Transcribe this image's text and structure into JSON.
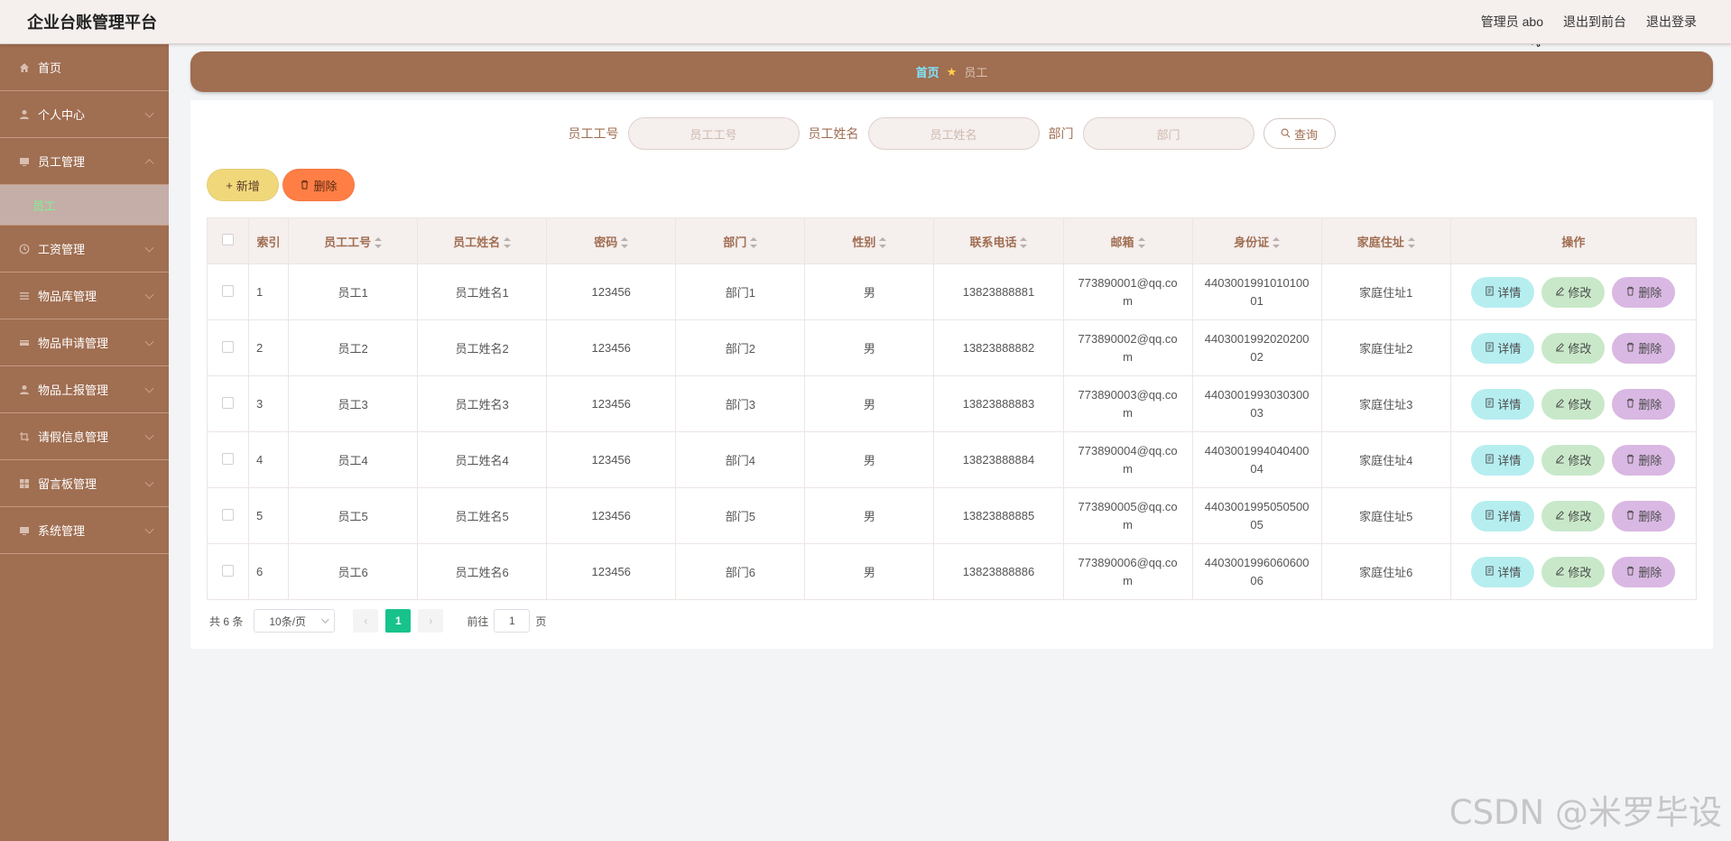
{
  "app": {
    "title": "企业台账管理平台"
  },
  "header": {
    "user": "管理员 abo",
    "to_front": "退出到前台",
    "logout": "退出登录"
  },
  "sidebar": {
    "items": [
      {
        "label": "首页",
        "icon": "home-icon"
      },
      {
        "label": "个人中心",
        "icon": "user-icon"
      },
      {
        "label": "员工管理",
        "icon": "monitor-icon"
      },
      {
        "label": "工资管理",
        "icon": "clock-icon"
      },
      {
        "label": "物品库管理",
        "icon": "list-icon"
      },
      {
        "label": "物品申请管理",
        "icon": "card-icon"
      },
      {
        "label": "物品上报管理",
        "icon": "user-icon"
      },
      {
        "label": "请假信息管理",
        "icon": "crop-icon"
      },
      {
        "label": "留言板管理",
        "icon": "grid-icon"
      },
      {
        "label": "系统管理",
        "icon": "monitor-icon"
      }
    ],
    "active_sub": "员工"
  },
  "breadcrumb": {
    "home": "首页",
    "current": "员工"
  },
  "search": {
    "no_label": "员工工号",
    "no_placeholder": "员工工号",
    "name_label": "员工姓名",
    "name_placeholder": "员工姓名",
    "dept_label": "部门",
    "dept_placeholder": "部门",
    "query": "查询"
  },
  "toolbar": {
    "add": "新增",
    "delete": "删除"
  },
  "table": {
    "headers": [
      "索引",
      "员工工号",
      "员工姓名",
      "密码",
      "部门",
      "性别",
      "联系电话",
      "邮箱",
      "身份证",
      "家庭住址",
      "操作"
    ],
    "rows": [
      [
        "1",
        "员工1",
        "员工姓名1",
        "123456",
        "部门1",
        "男",
        "13823888881",
        "773890001@qq.com",
        "440300199101010001",
        "家庭住址1"
      ],
      [
        "2",
        "员工2",
        "员工姓名2",
        "123456",
        "部门2",
        "男",
        "13823888882",
        "773890002@qq.com",
        "440300199202020002",
        "家庭住址2"
      ],
      [
        "3",
        "员工3",
        "员工姓名3",
        "123456",
        "部门3",
        "男",
        "13823888883",
        "773890003@qq.com",
        "440300199303030003",
        "家庭住址3"
      ],
      [
        "4",
        "员工4",
        "员工姓名4",
        "123456",
        "部门4",
        "男",
        "13823888884",
        "773890004@qq.com",
        "440300199404040004",
        "家庭住址4"
      ],
      [
        "5",
        "员工5",
        "员工姓名5",
        "123456",
        "部门5",
        "男",
        "13823888885",
        "773890005@qq.com",
        "440300199505050005",
        "家庭住址5"
      ],
      [
        "6",
        "员工6",
        "员工姓名6",
        "123456",
        "部门6",
        "男",
        "13823888886",
        "773890006@qq.com",
        "440300199606060006",
        "家庭住址6"
      ]
    ],
    "ops": {
      "detail": "详情",
      "edit": "修改",
      "remove": "删除"
    }
  },
  "pager": {
    "total": "共 6 条",
    "size": "10条/页",
    "prev": "‹",
    "next": "›",
    "page": "1",
    "goto_label": "前往",
    "goto_value": "1",
    "goto_suffix": "页"
  },
  "watermark": "CSDN @米罗毕设",
  "colors": {
    "primary": "#a06e51",
    "accent_green": "#17c38b",
    "add": "#f0d87a",
    "delete": "#ff7e45"
  }
}
